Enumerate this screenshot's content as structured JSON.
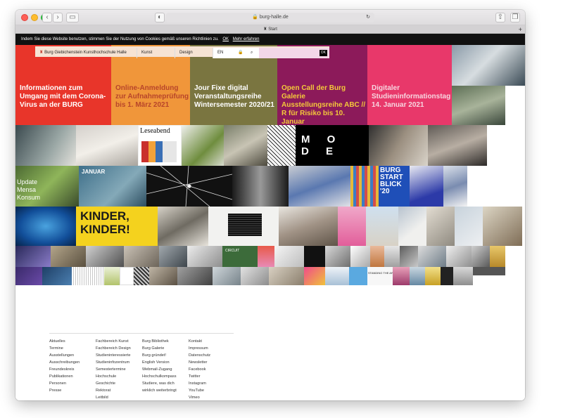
{
  "browser": {
    "url": "burg-halle.de",
    "tab_title": "Start"
  },
  "cookie_banner": {
    "text": "Indem Sie diese Website benutzen, stimmen Sie der Nutzung von Cookies gemäß unseren Richtlinien zu.",
    "ok": "OK",
    "more": "Mehr erfahren"
  },
  "nav": {
    "logo_text": "Burg Giebichenstein Kunsthochschule Halle",
    "kunst": "Kunst",
    "design": "Design",
    "lang": "EN",
    "ok": "OK"
  },
  "tiles": [
    {
      "text": "Informationen zum Umgang mit dem Corona-Virus an der BURG",
      "color": "#e8352a",
      "text_color": "#ffffff"
    },
    {
      "text": "Online-Anmeldung zur Aufnahmeprüfung bis 1. März 2021",
      "color": "#f0963a",
      "text_color": "#b8452a"
    },
    {
      "text": "Jour Fixe digital Veranstaltungsreihe Wintersemester 2020/21",
      "color": "#7a7540",
      "text_color": "#ffffff"
    },
    {
      "text": "Open Call der Burg Galerie Ausstellungsreihe ABC // R für Risiko bis 10. Januar",
      "color": "#8c1a5a",
      "text_color": "#f4c93a"
    },
    {
      "text": "Digitaler Studieninformationstag 14. Januar 2021",
      "color": "#e8386a",
      "text_color": "#f7d6e0"
    }
  ],
  "image_labels": {
    "leseabend": "Leseabend",
    "mode": "M O D E",
    "update_mensa": "Update Mensa Konsum",
    "januar": "JANUAR",
    "burg_start": "BURG START BLICK '20",
    "kinder": "KINDER, KINDER!",
    "circuit": "CIRCUIT",
    "standing": "STANDING THE ARTS"
  },
  "footer": {
    "col1": [
      "Aktuelles",
      "Termine",
      "Ausstellungen",
      "Ausschreibungen",
      "Freundeskreis",
      "Publikationen",
      "Personen",
      "Presse"
    ],
    "col2": [
      "Fachbereich Kunst",
      "Fachbereich Design",
      "Studieninteressierte",
      "Studieninfozentrum",
      "Semestertermine",
      "Hochschule",
      "Geschichte",
      "Rektorat",
      "Leitbild"
    ],
    "col3": [
      "Burg Bibliothek",
      "Burg Galerie",
      "Burg gründet!",
      "English Version",
      "Webmail-Zugang",
      "Hochschulkompass",
      "Studiere, was dich",
      "wirklich weiterbringt"
    ],
    "col4": [
      "Kontakt",
      "Impressum",
      "Datenschutz",
      "Newsletter",
      "Facebook",
      "Twitter",
      "Instagram",
      "YouTube",
      "Vimeo"
    ]
  }
}
